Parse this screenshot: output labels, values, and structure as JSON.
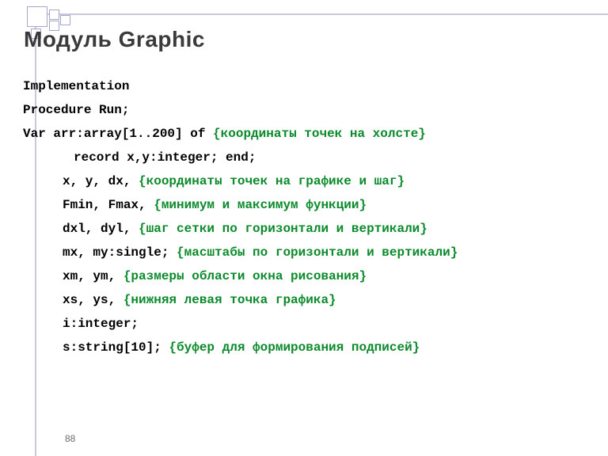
{
  "title": "Модуль Graphic",
  "page": "88",
  "lines": [
    {
      "a": "Implementation"
    },
    {
      "a": "Procedure Run;"
    },
    {
      "a": "Var  arr:array[1..200] of ",
      "c": "{координаты точек на холсте}"
    },
    {
      "a": "record x,y:integer; end;"
    },
    {
      "a": "x, y, dx, ",
      "c": "{координаты точек на графике и шаг}"
    },
    {
      "a": "Fmin, Fmax, ",
      "c": "{минимум и максимум функции}"
    },
    {
      "a": "dxl, dyl,   ",
      "c": "{шаг сетки по горизонтали и вертикали}"
    },
    {
      "a": "mx, my:single; ",
      "c": "{масштабы по горизонтали и вертикали}"
    },
    {
      "a": "xm, ym,   ",
      "c": "{размеры области окна рисования}"
    },
    {
      "a": "xs, ys,      ",
      "c": "{нижняя левая точка графика}"
    },
    {
      "a": "i:integer;"
    },
    {
      "a": "s:string[10]; ",
      "c": "{буфер для формирования подписей}"
    }
  ]
}
